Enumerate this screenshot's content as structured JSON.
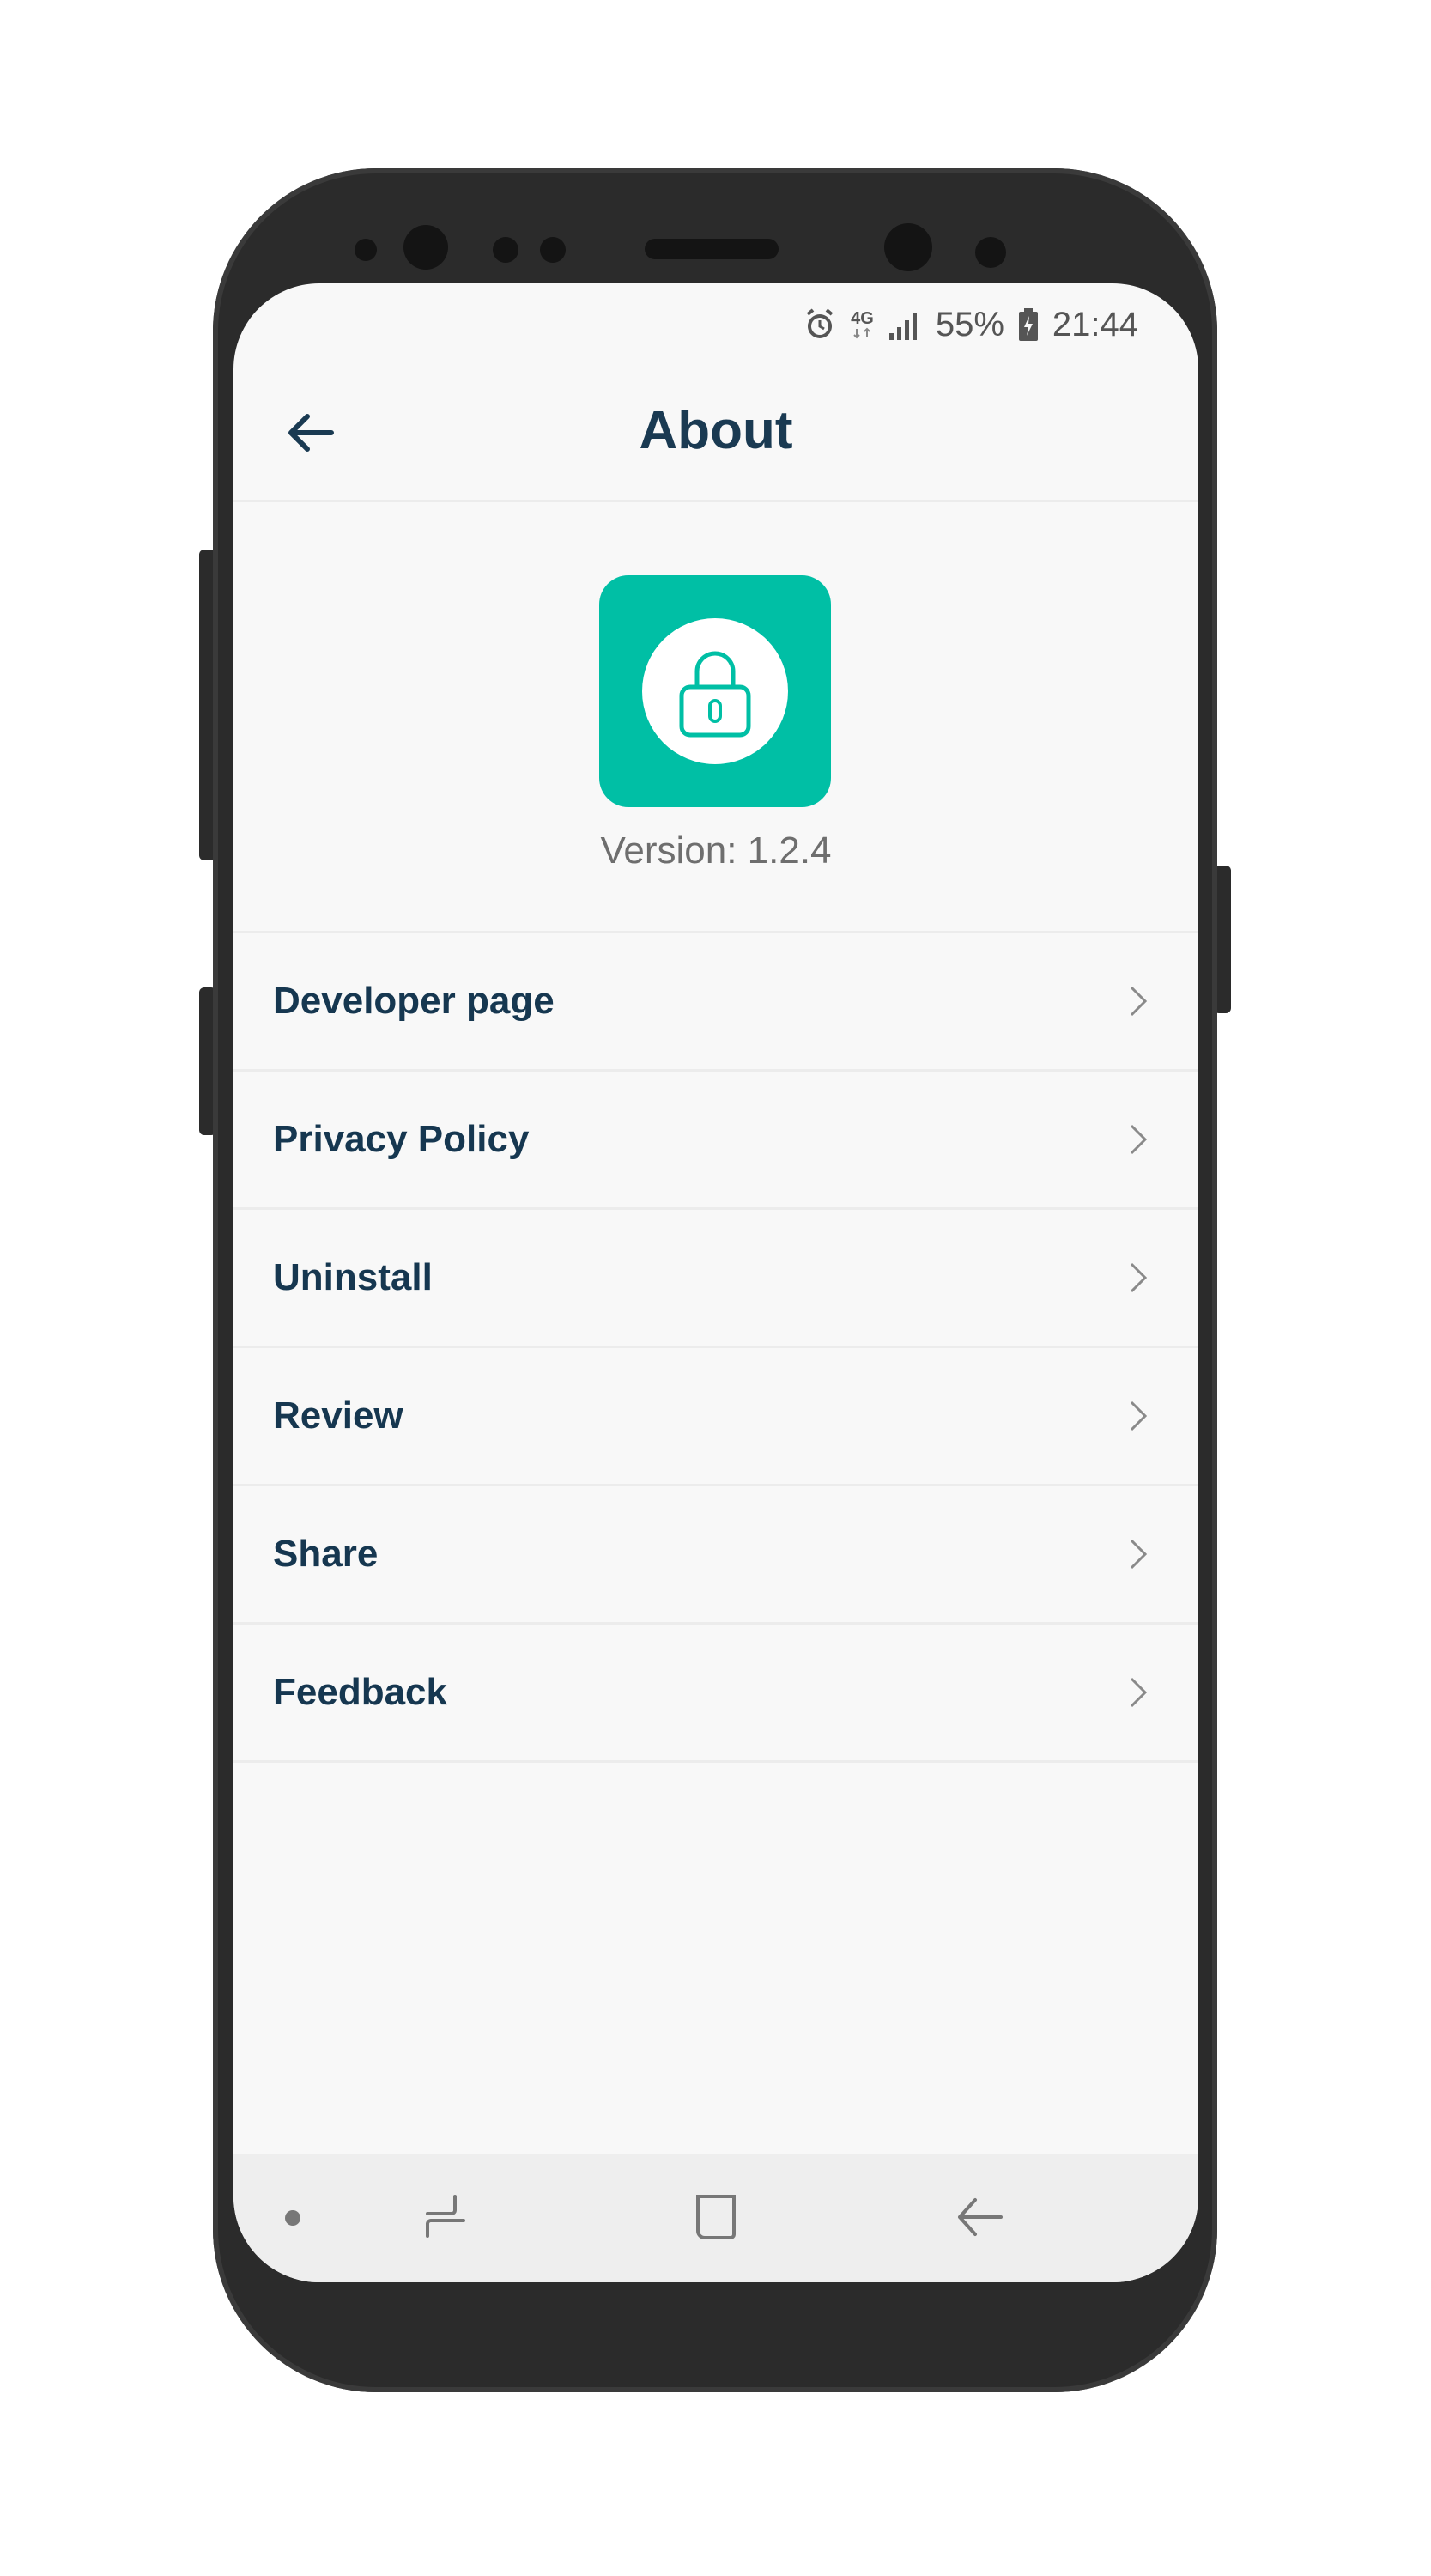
{
  "status_bar": {
    "network": "4G",
    "battery": "55%",
    "time": "21:44",
    "icons": [
      "alarm-icon",
      "network-4g-icon",
      "signal-icon",
      "battery-icon"
    ]
  },
  "header": {
    "title": "About",
    "back_icon": "arrow-left-icon"
  },
  "app": {
    "icon": "lock-icon",
    "icon_color": "#00bfa5",
    "version": "Version: 1.2.4"
  },
  "menu": {
    "items": [
      {
        "label": "Developer page"
      },
      {
        "label": "Privacy Policy"
      },
      {
        "label": "Uninstall"
      },
      {
        "label": "Review"
      },
      {
        "label": "Share"
      },
      {
        "label": "Feedback"
      }
    ]
  },
  "colors": {
    "title_text": "#1a3a52",
    "accent": "#00bfa5",
    "screen_bg": "#f8f8f8",
    "phone_body": "#2b2b2b"
  }
}
